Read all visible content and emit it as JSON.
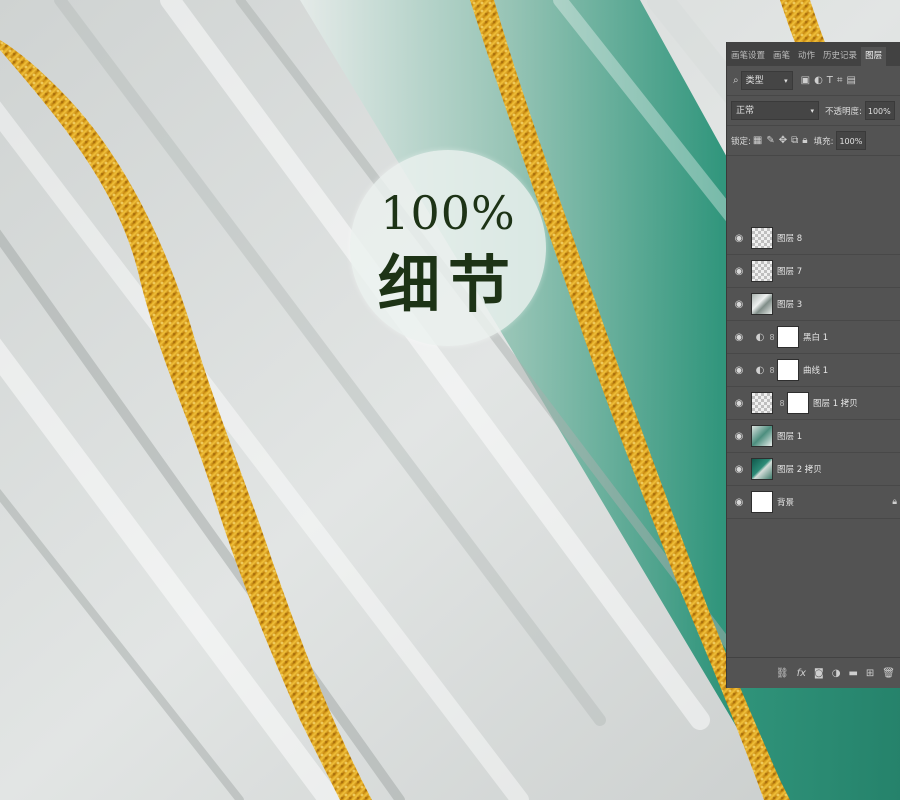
{
  "badge": {
    "percent": "100%",
    "text": "细节"
  },
  "panel": {
    "tabs": [
      {
        "label": "画笔设置",
        "active": false
      },
      {
        "label": "画笔",
        "active": false
      },
      {
        "label": "动作",
        "active": false
      },
      {
        "label": "历史记录",
        "active": false
      },
      {
        "label": "图层",
        "active": true
      }
    ],
    "filter": {
      "label": "类型",
      "icons": [
        "image-filter-icon",
        "adjustment-filter-icon",
        "type-filter-icon",
        "shape-filter-icon",
        "smart-object-filter-icon"
      ]
    },
    "blend_mode": "正常",
    "opacity": {
      "label": "不透明度:",
      "value": "100%"
    },
    "lock": {
      "label": "锁定:",
      "icons": [
        "lock-transparent-icon",
        "lock-paint-icon",
        "lock-move-icon",
        "lock-artboard-icon",
        "lock-all-icon"
      ]
    },
    "fill": {
      "label": "填充:",
      "value": "100%"
    },
    "layers": [
      {
        "name": "图层 8",
        "thumb": "trans",
        "adjust": false,
        "mask": false
      },
      {
        "name": "图层 7",
        "thumb": "trans",
        "adjust": false,
        "mask": false
      },
      {
        "name": "图层 3",
        "thumb": "tex",
        "adjust": false,
        "mask": false
      },
      {
        "name": "黑白 1",
        "thumb": "white",
        "adjust": true,
        "mask": true
      },
      {
        "name": "曲线 1",
        "thumb": "white",
        "adjust": true,
        "mask": true
      },
      {
        "name": "图层 1 拷贝",
        "thumb": "trans",
        "adjust": false,
        "mask": true
      },
      {
        "name": "图层 1",
        "thumb": "tealw",
        "adjust": false,
        "mask": false
      },
      {
        "name": "图层 2 拷贝",
        "thumb": "teal",
        "adjust": false,
        "mask": false
      },
      {
        "name": "背景",
        "thumb": "white",
        "adjust": false,
        "mask": false,
        "locked": true
      }
    ],
    "bottom_icons": [
      "link-layers-icon",
      "fx-icon",
      "add-mask-icon",
      "adjustment-layer-icon",
      "group-folder-icon",
      "new-layer-icon",
      "trash-icon"
    ]
  },
  "colors": {
    "gold": "#e0a81a",
    "teal": "#1e8a70",
    "panel": "#535353"
  }
}
